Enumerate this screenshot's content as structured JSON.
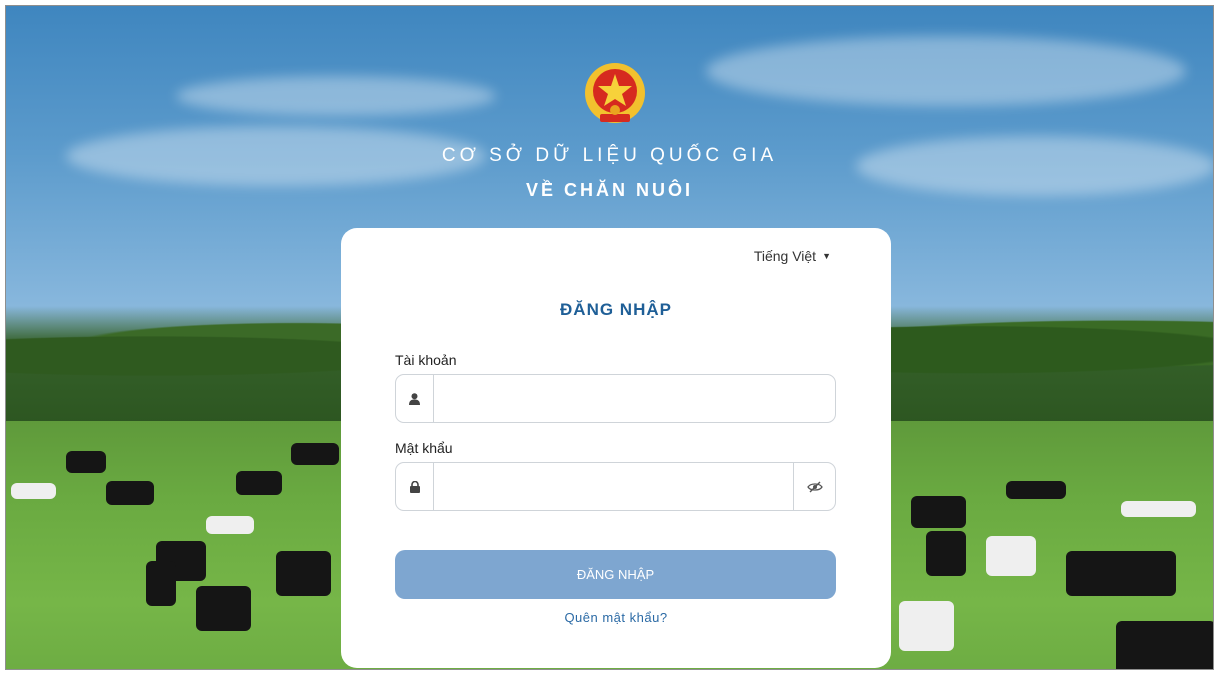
{
  "header": {
    "title_line1": "CƠ SỞ DỮ LIỆU QUỐC GIA",
    "title_line2": "VỀ CHĂN NUÔI"
  },
  "login": {
    "language": "Tiếng Việt",
    "title": "ĐĂNG NHẬP",
    "username_label": "Tài khoản",
    "username_value": "",
    "password_label": "Mật khẩu",
    "password_value": "",
    "submit_label": "ĐĂNG NHẬP",
    "forgot_label": "Quên mật khẩu?"
  },
  "icons": {
    "emblem": "national-emblem-icon",
    "user": "user-icon",
    "lock": "lock-icon",
    "toggle_password": "eye-slash-icon",
    "language_caret": "caret-down-icon"
  },
  "colors": {
    "title_blue": "#1f5f97",
    "button_bg": "#7ea6d0",
    "link": "#2b6aa5",
    "emblem_red": "#d62a1f",
    "emblem_gold": "#f2c12e"
  }
}
